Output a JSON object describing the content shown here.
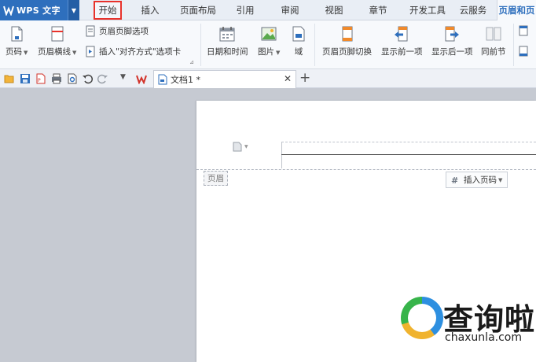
{
  "app": {
    "name": "WPS 文字"
  },
  "menu": {
    "tabs": [
      {
        "label": "开始"
      },
      {
        "label": "插入"
      },
      {
        "label": "页面布局"
      },
      {
        "label": "引用"
      },
      {
        "label": "审阅"
      },
      {
        "label": "视图"
      },
      {
        "label": "章节"
      },
      {
        "label": "开发工具"
      },
      {
        "label": "云服务"
      },
      {
        "label": "页眉和页"
      }
    ]
  },
  "ribbon": {
    "page_number": "页码",
    "header_line": "页眉横线",
    "hf_options": "页眉页脚选项",
    "insert_align_tab": "插入\"对齐方式\"选项卡",
    "date_time": "日期和时间",
    "picture": "图片",
    "field": "域",
    "hf_switch": "页眉页脚切换",
    "show_prev": "显示前一项",
    "show_next": "显示后一项",
    "same_as_prev": "同前节"
  },
  "document": {
    "tab_title": "文档1 *",
    "header_label": "页眉",
    "insert_page_number": "插入页码"
  },
  "watermark": {
    "cn": "查询啦",
    "en": "chaxunla.com"
  },
  "colors": {
    "accent": "#2e6fbd",
    "highlight_border": "#e8322b"
  }
}
